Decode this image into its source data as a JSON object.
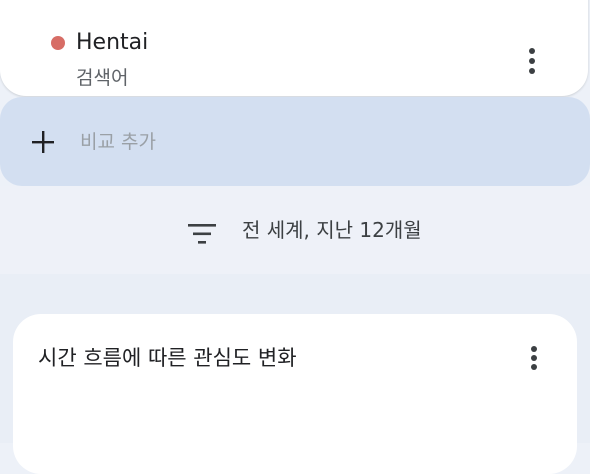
{
  "search_term": {
    "label": "Hentai",
    "type": "검색어",
    "color": "#d76d66",
    "menu_icon": "more-vert-icon"
  },
  "compare": {
    "label": "비교 추가",
    "icon": "plus-icon"
  },
  "filter": {
    "label": "전 세계, 지난 12개월",
    "icon": "filter-list-icon"
  },
  "interest_card": {
    "title": "시간 흐름에 따른 관심도 변화",
    "menu_icon": "more-vert-icon"
  },
  "colors": {
    "background": "#edf1f8",
    "compare_bar": "#d3dff1",
    "card": "#ffffff"
  }
}
